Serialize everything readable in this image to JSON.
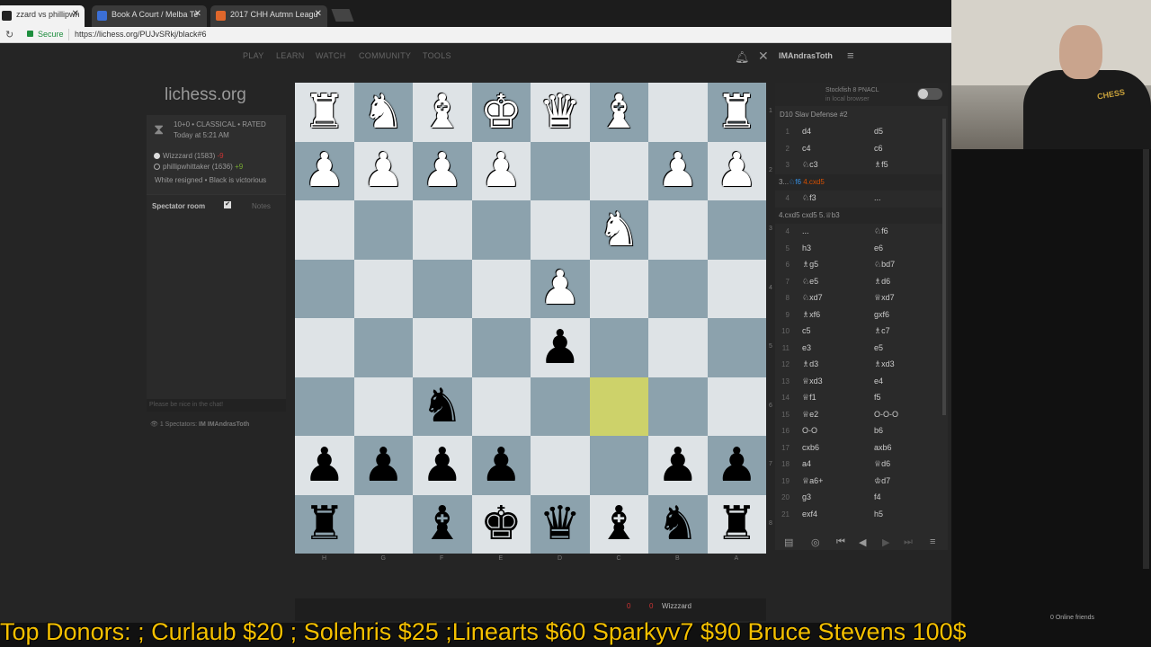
{
  "tabs": [
    {
      "label": "zzard vs phillipwh",
      "active": true,
      "icon_color": "#222"
    },
    {
      "label": "Book A Court / Melba Te",
      "active": false,
      "icon_color": "#3b6fd6"
    },
    {
      "label": "2017 CHH Autmn Leagu",
      "active": false,
      "icon_color": "#e0672b"
    }
  ],
  "address": {
    "secure": "Secure",
    "url": "https://lichess.org/PUJvSRkj/black#6"
  },
  "nav": {
    "play": "PLAY",
    "learn": "LEARN",
    "watch": "WATCH",
    "community": "COMMUNITY",
    "tools": "TOOLS",
    "username": "IMAndrasToth"
  },
  "logo": "lichess.org",
  "game": {
    "type": "10+0 • CLASSICAL • RATED",
    "when": "Today at 5:21 AM",
    "player_white": "Wizzzard (1583)",
    "player_white_diff": "-9",
    "player_black": "phillipwhittaker (1636)",
    "player_black_diff": "+9",
    "result": "White resigned • Black is victorious"
  },
  "chat": {
    "title": "Spectator room",
    "notes": "Notes",
    "placeholder": "Please be nice in the chat!",
    "spectators_count": "1 Spectators:",
    "spectators": "IM IMAndrasToth"
  },
  "board": {
    "rows": [
      [
        "wR",
        "wN",
        "wB",
        "wK",
        "wQ",
        "wB",
        "",
        "wR"
      ],
      [
        "wP",
        "wP",
        "wP",
        "wP",
        "",
        "",
        "wP",
        "wP"
      ],
      [
        "",
        "",
        "",
        "",
        "",
        "wN",
        "",
        ""
      ],
      [
        "",
        "",
        "",
        "",
        "wP",
        "",
        "",
        ""
      ],
      [
        "",
        "",
        "",
        "",
        "bP",
        "",
        "",
        ""
      ],
      [
        "",
        "",
        "bN",
        "",
        "",
        "",
        "",
        ""
      ],
      [
        "bP",
        "bP",
        "bP",
        "bP",
        "",
        "",
        "bP",
        "bP"
      ],
      [
        "bR",
        "",
        "bB",
        "bK",
        "bQ",
        "bB",
        "bN",
        "bR"
      ]
    ],
    "highlight": [
      5,
      5
    ],
    "files": [
      "H",
      "G",
      "F",
      "E",
      "D",
      "C",
      "B",
      "A"
    ],
    "ranks": [
      "1",
      "2",
      "3",
      "4",
      "5",
      "6",
      "7",
      "8"
    ]
  },
  "engine": {
    "name": "Stockfish 8 PNACL",
    "note": "in local browser"
  },
  "opening": "D10 Slav Defense #2",
  "moves_before": [
    {
      "n": "1",
      "w": "d4",
      "b": "d5"
    },
    {
      "n": "2",
      "w": "c4",
      "b": "c6"
    },
    {
      "n": "3",
      "w": "♘c3",
      "b": "♗f5"
    }
  ],
  "variation1": {
    "prefix": "3...",
    "a": "♘f6",
    "b": "4.cxd5"
  },
  "move4": {
    "n": "4",
    "w": "♘f3",
    "b": "..."
  },
  "variation2": "4.cxd5 cxd5 5.♕b3",
  "moves_after": [
    {
      "n": "4",
      "w": "...",
      "b": "♘f6"
    },
    {
      "n": "5",
      "w": "h3",
      "b": "e6"
    },
    {
      "n": "6",
      "w": "♗g5",
      "b": "♘bd7"
    },
    {
      "n": "7",
      "w": "♘e5",
      "b": "♗d6"
    },
    {
      "n": "8",
      "w": "♘xd7",
      "b": "♕xd7"
    },
    {
      "n": "9",
      "w": "♗xf6",
      "b": "gxf6"
    },
    {
      "n": "10",
      "w": "c5",
      "b": "♗c7"
    },
    {
      "n": "11",
      "w": "e3",
      "b": "e5"
    },
    {
      "n": "12",
      "w": "♗d3",
      "b": "♗xd3"
    },
    {
      "n": "13",
      "w": "♕xd3",
      "b": "e4"
    },
    {
      "n": "14",
      "w": "♕f1",
      "b": "f5"
    },
    {
      "n": "15",
      "w": "♕e2",
      "b": "O-O-O"
    },
    {
      "n": "16",
      "w": "O-O",
      "b": "b6"
    },
    {
      "n": "17",
      "w": "cxb6",
      "b": "axb6"
    },
    {
      "n": "18",
      "w": "a4",
      "b": "♕d6"
    },
    {
      "n": "19",
      "w": "♕a6+",
      "b": "♔d7"
    },
    {
      "n": "20",
      "w": "g3",
      "b": "f4"
    },
    {
      "n": "21",
      "w": "exf4",
      "b": "h5"
    }
  ],
  "clock": {
    "left": "0",
    "right": "0",
    "player": "Wizzzard"
  },
  "ticker": "Top Donors: ; Curlaub $20 ; Solehris $25 ;Linearts $60 Sparkyv7 $90 Bruce Stevens 100$",
  "online": "0 Online friends",
  "webcam_logo": "CHESS"
}
